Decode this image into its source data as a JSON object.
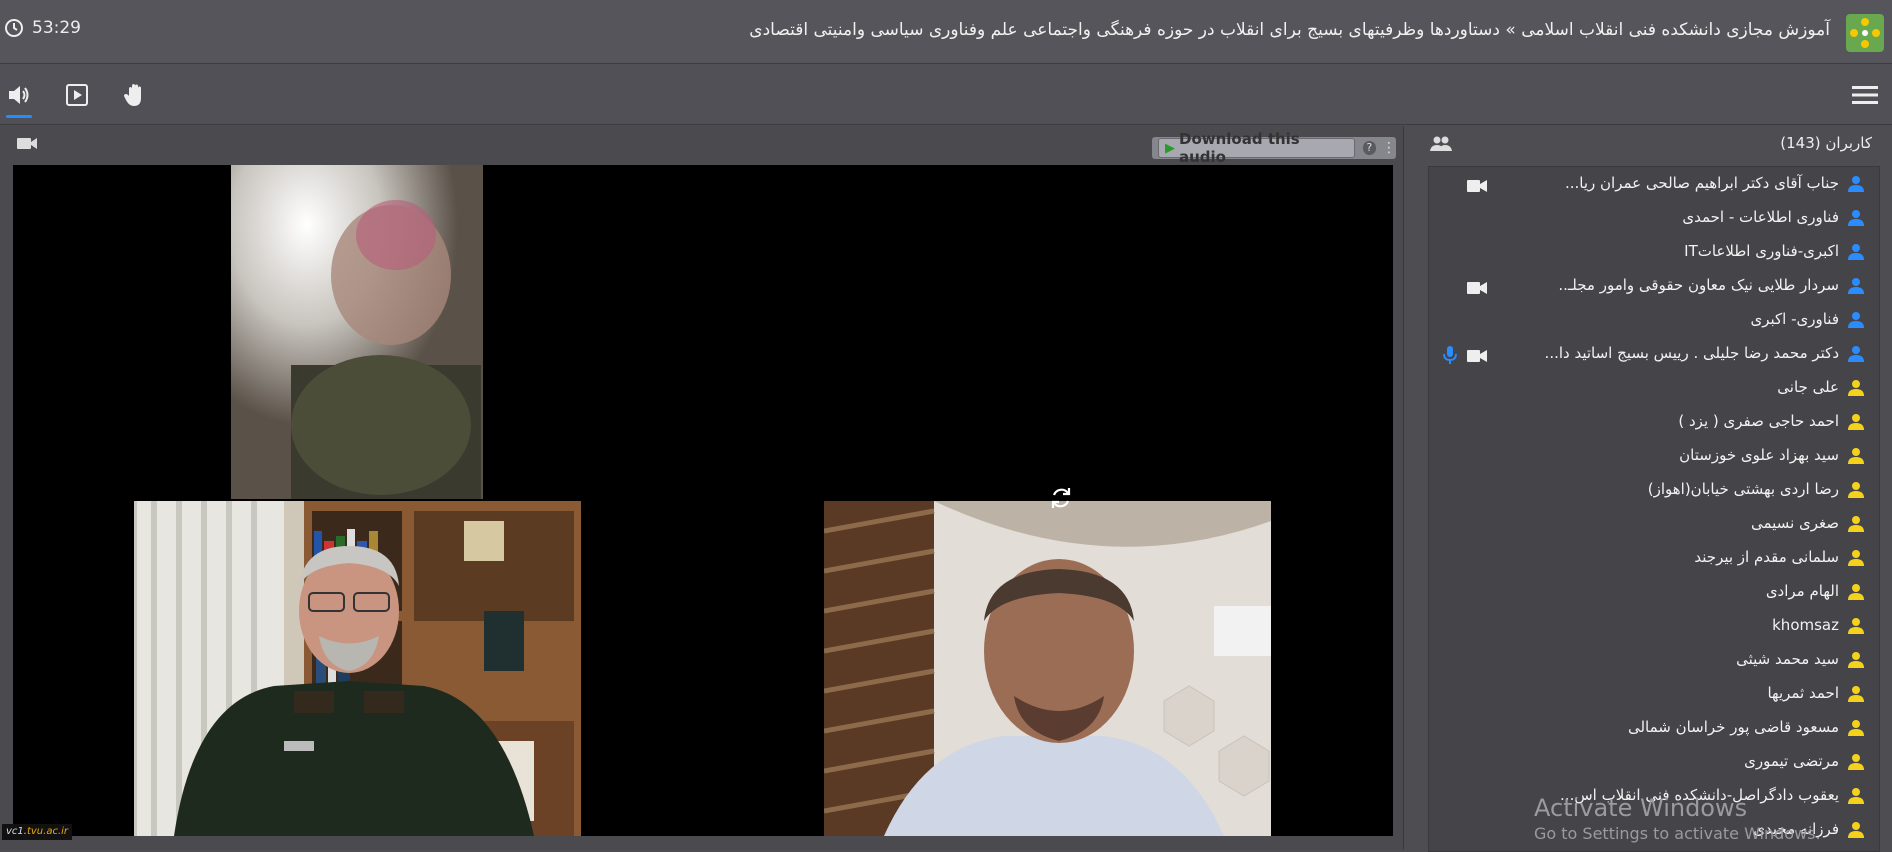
{
  "header": {
    "title": "آموزش مجازی دانشکده فنی انقلاب اسلامی » دستاوردها وظرفیتهای بسیج برای انقلاب در حوزه فرهنگی واجتماعی علم وفناوری سیاسی وامنیتی اقتصادی",
    "timer": "53:29",
    "logo_icon": "app-logo-icon"
  },
  "toolbar": {
    "items": [
      {
        "name": "speaker-icon",
        "active": true
      },
      {
        "name": "media-player-icon",
        "active": false
      },
      {
        "name": "raise-hand-icon",
        "active": false
      }
    ],
    "menu_icon": "hamburger-menu-icon"
  },
  "video": {
    "download_label": "Download this audio",
    "help_label": "?",
    "watermark_prefix": "vc1.",
    "watermark_domain": "tvu.ac.ir"
  },
  "users": {
    "title": "کاربران (143)",
    "list": [
      {
        "name": "جناب آقای دکتر ابراهیم صالحی عمران ریا...",
        "role": "presenter",
        "cam": true,
        "mic": false
      },
      {
        "name": "فناوری اطلاعات - احمدی",
        "role": "presenter",
        "cam": false,
        "mic": false
      },
      {
        "name": "اکبری-فناوری اطلاعاتIT",
        "role": "presenter",
        "cam": false,
        "mic": false
      },
      {
        "name": "سردار طلایی نیک معاون حقوقی وامور مجلـ..",
        "role": "presenter",
        "cam": true,
        "mic": false
      },
      {
        "name": "فناوری- اکبری",
        "role": "presenter",
        "cam": false,
        "mic": false
      },
      {
        "name": "دکتر محمد رضا جلیلی . رییس بسیج اساتید دا...",
        "role": "presenter",
        "cam": true,
        "mic": true
      },
      {
        "name": "علی جانی",
        "role": "participant",
        "cam": false,
        "mic": false
      },
      {
        "name": "احمد حاجی صفری ( یزد )",
        "role": "participant",
        "cam": false,
        "mic": false
      },
      {
        "name": "سید بهزاد علوی خوزستان",
        "role": "participant",
        "cam": false,
        "mic": false
      },
      {
        "name": "رضا اردی بهشتی خیابان(اهواز)",
        "role": "participant",
        "cam": false,
        "mic": false
      },
      {
        "name": "صغری نسیمی",
        "role": "participant",
        "cam": false,
        "mic": false
      },
      {
        "name": "سلمانی مقدم از بیرجند",
        "role": "participant",
        "cam": false,
        "mic": false
      },
      {
        "name": "الهام مرادی",
        "role": "participant",
        "cam": false,
        "mic": false
      },
      {
        "name": "khomsaz",
        "role": "participant",
        "cam": false,
        "mic": false
      },
      {
        "name": "سید محمد شیثی",
        "role": "participant",
        "cam": false,
        "mic": false
      },
      {
        "name": "احمد ثمریها",
        "role": "participant",
        "cam": false,
        "mic": false
      },
      {
        "name": "مسعود قاضی پور خراسان شمالی",
        "role": "participant",
        "cam": false,
        "mic": false
      },
      {
        "name": "مرتضی تیموری",
        "role": "participant",
        "cam": false,
        "mic": false
      },
      {
        "name": "یعقوب دادگراصل-دانشکده فنی انقلاب اس...",
        "role": "participant",
        "cam": false,
        "mic": false
      },
      {
        "name": "فرزانه مجیدی",
        "role": "participant",
        "cam": false,
        "mic": false
      }
    ]
  },
  "overlay": {
    "activate_title": "Activate Windows",
    "activate_sub": "Go to Settings to activate Windows."
  },
  "colors": {
    "presenter": "#2b8cff",
    "participant": "#f4d21c",
    "accent": "#1e8fff"
  }
}
